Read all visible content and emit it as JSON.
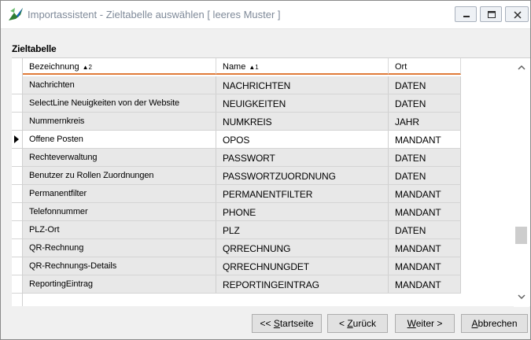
{
  "window": {
    "title": "Importassistent - Zieltabelle auswählen [ leeres Muster ]",
    "icon": "importassistant-app-icon"
  },
  "section": {
    "label": "Zieltabelle"
  },
  "grid": {
    "columns": [
      {
        "label": "Bezeichnung",
        "sort_arrow": "▲",
        "sort_order": "2"
      },
      {
        "label": "Name",
        "sort_arrow": "▲",
        "sort_order": "1"
      },
      {
        "label": "Ort",
        "sort_arrow": "",
        "sort_order": ""
      }
    ],
    "rows": [
      {
        "bez": "Nachrichten",
        "name": "NACHRICHTEN",
        "ort": "DATEN",
        "selected": false
      },
      {
        "bez": "SelectLine Neuigkeiten von der Website",
        "name": "NEUIGKEITEN",
        "ort": "DATEN",
        "selected": false
      },
      {
        "bez": "Nummernkreis",
        "name": "NUMKREIS",
        "ort": "JAHR",
        "selected": false
      },
      {
        "bez": "Offene Posten",
        "name": "OPOS",
        "ort": "MANDANT",
        "selected": true
      },
      {
        "bez": "Rechteverwaltung",
        "name": "PASSWORT",
        "ort": "DATEN",
        "selected": false
      },
      {
        "bez": "Benutzer zu Rollen Zuordnungen",
        "name": "PASSWORTZUORDNUNG",
        "ort": "DATEN",
        "selected": false
      },
      {
        "bez": "Permanentfilter",
        "name": "PERMANENTFILTER",
        "ort": "MANDANT",
        "selected": false
      },
      {
        "bez": "Telefonnummer",
        "name": "PHONE",
        "ort": "MANDANT",
        "selected": false
      },
      {
        "bez": "PLZ-Ort",
        "name": "PLZ",
        "ort": "DATEN",
        "selected": false
      },
      {
        "bez": "QR-Rechnung",
        "name": "QRRECHNUNG",
        "ort": "MANDANT",
        "selected": false
      },
      {
        "bez": "QR-Rechnungs-Details",
        "name": "QRRECHNUNGDET",
        "ort": "MANDANT",
        "selected": false
      },
      {
        "bez": "ReportingEintrag",
        "name": "REPORTINGEINTRAG",
        "ort": "MANDANT",
        "selected": false
      }
    ]
  },
  "buttons": {
    "start": {
      "prefix": "<< ",
      "mnemonic": "S",
      "rest": "tartseite"
    },
    "back": {
      "prefix": "< ",
      "mnemonic": "Z",
      "rest": "urück"
    },
    "next": {
      "prefix": "",
      "mnemonic": "W",
      "rest": "eiter >"
    },
    "cancel": {
      "prefix": "",
      "mnemonic": "A",
      "rest": "bbrechen"
    }
  },
  "colors": {
    "header_sort_underline": "#e07b39",
    "row_alt": "#e8e8e8",
    "title_text": "#7f8a99"
  }
}
